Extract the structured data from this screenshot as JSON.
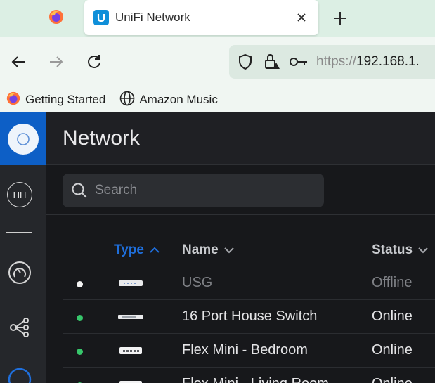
{
  "browser": {
    "tabs": [
      {
        "title": "",
        "icon": "firefox-icon"
      },
      {
        "title": "UniFi Network",
        "icon": "unifi-icon",
        "active": true
      }
    ],
    "url": {
      "scheme": "https://",
      "host": "192.168.1."
    },
    "bookmarks": [
      {
        "label": "Getting Started",
        "icon": "firefox-icon"
      },
      {
        "label": "Amazon Music",
        "icon": "globe-icon"
      }
    ]
  },
  "sidebar": {
    "avatar": "HH"
  },
  "page": {
    "title": "Network",
    "search_placeholder": "Search"
  },
  "table": {
    "columns": [
      {
        "label": "Type",
        "sorted": "ascending"
      },
      {
        "label": "Name"
      },
      {
        "label": "Status"
      }
    ],
    "rows": [
      {
        "status_color": "#f2f2f2",
        "device_icon": "gateway-device-icon",
        "name": "USG",
        "status": "Offline",
        "online": false
      },
      {
        "status_color": "#37c66b",
        "device_icon": "switch-device-icon",
        "name": "16 Port House Switch",
        "status": "Online",
        "online": true
      },
      {
        "status_color": "#37c66b",
        "device_icon": "flex-mini-device-icon",
        "name": "Flex Mini - Bedroom",
        "status": "Online",
        "online": true
      },
      {
        "status_color": "#37c66b",
        "device_icon": "flex-mini-device-icon",
        "name": "Flex Mini - Living Room",
        "status": "Online",
        "online": true
      }
    ]
  },
  "colors": {
    "accent": "#1f6fdc",
    "online": "#37c66b",
    "offline_text": "#7f8186",
    "online_text": "#e4e4e6"
  }
}
